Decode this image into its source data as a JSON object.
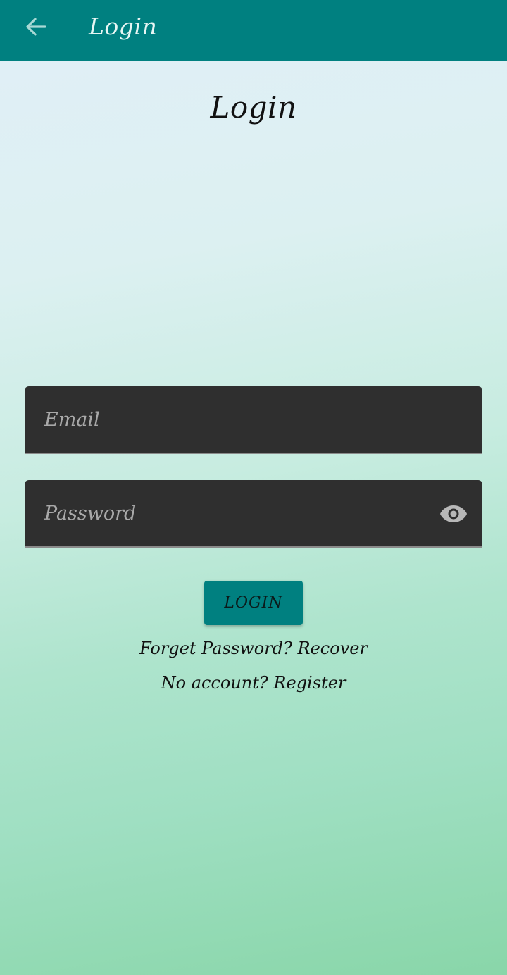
{
  "app_bar": {
    "title": "Login",
    "back_icon": "arrow-left-icon",
    "background": "#008080"
  },
  "page": {
    "title": "Login"
  },
  "form": {
    "email": {
      "placeholder": "Email",
      "value": ""
    },
    "password": {
      "placeholder": "Password",
      "value": "",
      "toggle_icon": "eye-icon"
    },
    "login_label": "LOGIN",
    "forgot_prompt": "Forget Password?",
    "recover_label": "Recover",
    "no_account_prompt": "No account?",
    "register_label": "Register"
  },
  "colors": {
    "accent": "#008080",
    "field_background": "#2f2f2f"
  }
}
